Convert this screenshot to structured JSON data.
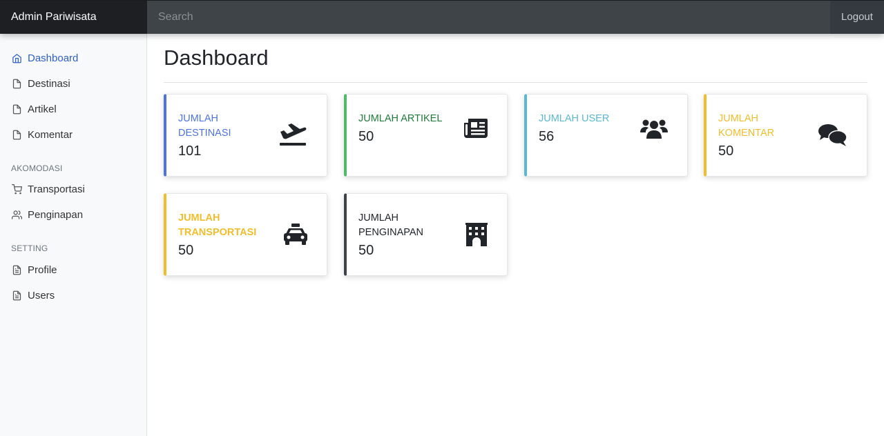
{
  "navbar": {
    "brand": "Admin Pariwisata",
    "search_placeholder": "Search",
    "logout_label": "Logout"
  },
  "sidebar": {
    "items": [
      {
        "label": "Dashboard",
        "icon": "home-icon",
        "active": true
      },
      {
        "label": "Destinasi",
        "icon": "file-icon"
      },
      {
        "label": "Artikel",
        "icon": "file-icon"
      },
      {
        "label": "Komentar",
        "icon": "file-icon"
      }
    ],
    "sections": [
      {
        "heading": "AKOMODASI",
        "items": [
          {
            "label": "Transportasi",
            "icon": "shopping-cart-icon"
          },
          {
            "label": "Penginapan",
            "icon": "users-icon"
          }
        ]
      },
      {
        "heading": "SETTING",
        "items": [
          {
            "label": "Profile",
            "icon": "file-text-icon"
          },
          {
            "label": "Users",
            "icon": "file-text-icon"
          }
        ]
      }
    ]
  },
  "main": {
    "title": "Dashboard",
    "cards": [
      {
        "label": "JUMLAH DESTINASI",
        "value": "101",
        "icon": "plane-departure-icon",
        "accent": "#4e73df"
      },
      {
        "label": "JUMLAH ARTIKEL",
        "value": "50",
        "icon": "newspaper-icon",
        "accent": "#52b96a",
        "label_color": "#1f7a3a"
      },
      {
        "label": "JUMLAH USER",
        "value": "56",
        "icon": "users-icon",
        "accent": "#5bb8cf"
      },
      {
        "label": "JUMLAH KOMENTAR",
        "value": "50",
        "icon": "comments-icon",
        "accent": "#f0be2c"
      },
      {
        "label": "JUMLAH TRANSPORTASI",
        "value": "50",
        "icon": "taxi-icon",
        "accent": "#f0be2c"
      },
      {
        "label": "JUMLAH PENGINAPAN",
        "value": "50",
        "icon": "hotel-icon",
        "accent": "#3e4249"
      }
    ]
  }
}
